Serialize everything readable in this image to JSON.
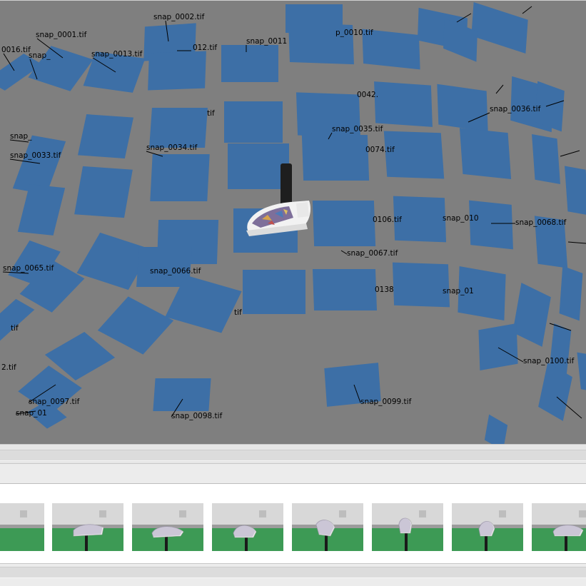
{
  "viewport": {
    "background": "#7f7f7f",
    "camera_color": "#3d6fa6",
    "labels": [
      "snap_0002.tif",
      "snap_0001.tif",
      "0016.tif",
      "snap_",
      "snap_0013.tif",
      "012.tif",
      "snap_0011",
      "p_0010.tif",
      "snap_0036.tif",
      "tif",
      "snap_0034.tif",
      "snap_0035.tif",
      "0074.tif",
      "snap_0033.tif",
      "snap_",
      "0042.",
      "snap_0068.tif",
      "snap_0067.tif",
      "snap_0066.tif",
      "snap_0065.tif",
      "0106.tif",
      "snap_010",
      "tif",
      "snap_0100.tif",
      "snap_0097.tif",
      "snap_01",
      "snap_0099.tif",
      "snap_0098.tif",
      "0138",
      "snap_01",
      "tif",
      "2.tif"
    ]
  },
  "filmstrip": {
    "frames": [
      {
        "id": "frame-1"
      },
      {
        "id": "frame-2"
      },
      {
        "id": "frame-3"
      },
      {
        "id": "frame-4"
      },
      {
        "id": "frame-5"
      },
      {
        "id": "frame-6"
      },
      {
        "id": "frame-7"
      },
      {
        "id": "frame-8"
      }
    ]
  }
}
